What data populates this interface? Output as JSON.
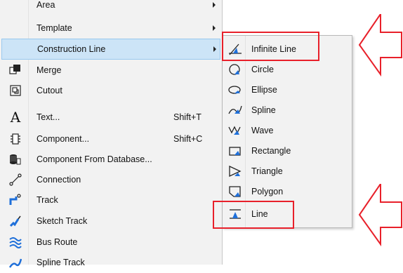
{
  "menu": {
    "items": [
      {
        "label": "Area",
        "icon": "none",
        "submenu": true
      },
      {
        "label": "Template",
        "icon": "none",
        "submenu": true
      },
      {
        "label": "Construction Line",
        "icon": "none",
        "submenu": true,
        "highlighted": true
      },
      {
        "label": "Merge",
        "icon": "merge-icon"
      },
      {
        "label": "Cutout",
        "icon": "cutout-icon"
      },
      {
        "label": "Text...",
        "icon": "text-icon",
        "shortcut": "Shift+T"
      },
      {
        "label": "Component...",
        "icon": "component-icon",
        "shortcut": "Shift+C"
      },
      {
        "label": "Component From Database...",
        "icon": "database-icon"
      },
      {
        "label": "Connection",
        "icon": "connection-icon"
      },
      {
        "label": "Track",
        "icon": "track-icon"
      },
      {
        "label": "Sketch Track",
        "icon": "sketch-track-icon"
      },
      {
        "label": "Bus Route",
        "icon": "bus-route-icon"
      },
      {
        "label": "Spline Track",
        "icon": "spline-track-icon"
      }
    ]
  },
  "submenu": {
    "items": [
      {
        "label": "Infinite Line",
        "icon": "infinite-line-icon"
      },
      {
        "label": "Circle",
        "icon": "circle-icon"
      },
      {
        "label": "Ellipse",
        "icon": "ellipse-icon"
      },
      {
        "label": "Spline",
        "icon": "spline-icon"
      },
      {
        "label": "Wave",
        "icon": "wave-icon"
      },
      {
        "label": "Rectangle",
        "icon": "rectangle-icon"
      },
      {
        "label": "Triangle",
        "icon": "triangle-icon"
      },
      {
        "label": "Polygon",
        "icon": "polygon-icon"
      },
      {
        "label": "Line",
        "icon": "line-icon"
      }
    ]
  },
  "colors": {
    "highlight_bg": "#cce4f7",
    "highlight_border": "#99c9ef",
    "annotation_red": "#e8202a",
    "icon_blue": "#1e6fd9"
  }
}
